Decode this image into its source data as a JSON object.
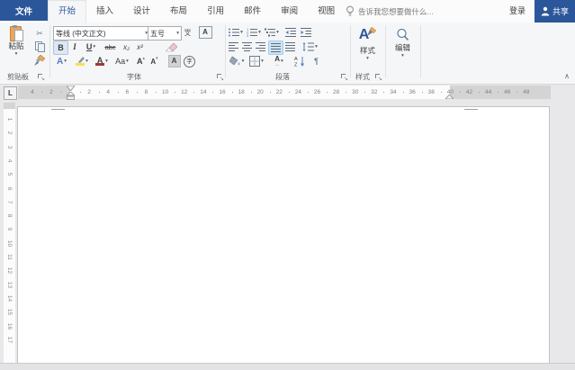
{
  "app": {
    "file_tab": "文件",
    "tabs": [
      "开始",
      "插入",
      "设计",
      "布局",
      "引用",
      "邮件",
      "审阅",
      "视图"
    ],
    "active_tab": "开始",
    "tellme": "告诉我您想要做什么...",
    "signin": "登录",
    "share": "共享"
  },
  "ribbon": {
    "clipboard": {
      "label": "剪贴板",
      "paste": "粘贴"
    },
    "font": {
      "label": "字体",
      "font_name": "等线 (中文正文)",
      "font_size": "五号",
      "bold": "B",
      "italic": "I",
      "underline": "U",
      "strikethrough": "abc",
      "subscript": "x₂",
      "superscript": "x²",
      "text_effects": "A",
      "font_color": "A",
      "change_case": "Aa",
      "grow_font": "A",
      "shrink_font": "A",
      "char_shading": "A",
      "enclose_char": "字",
      "phonetic_top": "wén",
      "phonetic_bottom": "文",
      "char_border": "A"
    },
    "paragraph": {
      "label": "段落",
      "sort_a": "A",
      "sort_z": "Z",
      "pilcrow": "¶",
      "asian": "A"
    },
    "styles": {
      "label": "样式",
      "button": "样式",
      "icon_letter": "A"
    },
    "editing": {
      "button": "编辑"
    }
  },
  "ruler": {
    "tab_selector": "L",
    "h_left_numbers": [
      4,
      2
    ],
    "h_numbers": [
      2,
      4,
      6,
      8,
      10,
      12,
      14,
      16,
      18,
      20,
      22,
      24,
      26,
      28,
      30,
      32,
      34,
      36,
      38,
      40,
      42,
      44,
      46,
      48
    ],
    "v_numbers": [
      1,
      2,
      3,
      4,
      5,
      6,
      7,
      8,
      9,
      10,
      11,
      12,
      13,
      14,
      15,
      16,
      17
    ]
  },
  "colors": {
    "accent": "#2b579a",
    "active_button_bg": "#cde4f7",
    "clipboard_tan": "#e9a75c",
    "highlight_yellow": "#f5e34b",
    "font_color_red": "#9e3a38"
  }
}
